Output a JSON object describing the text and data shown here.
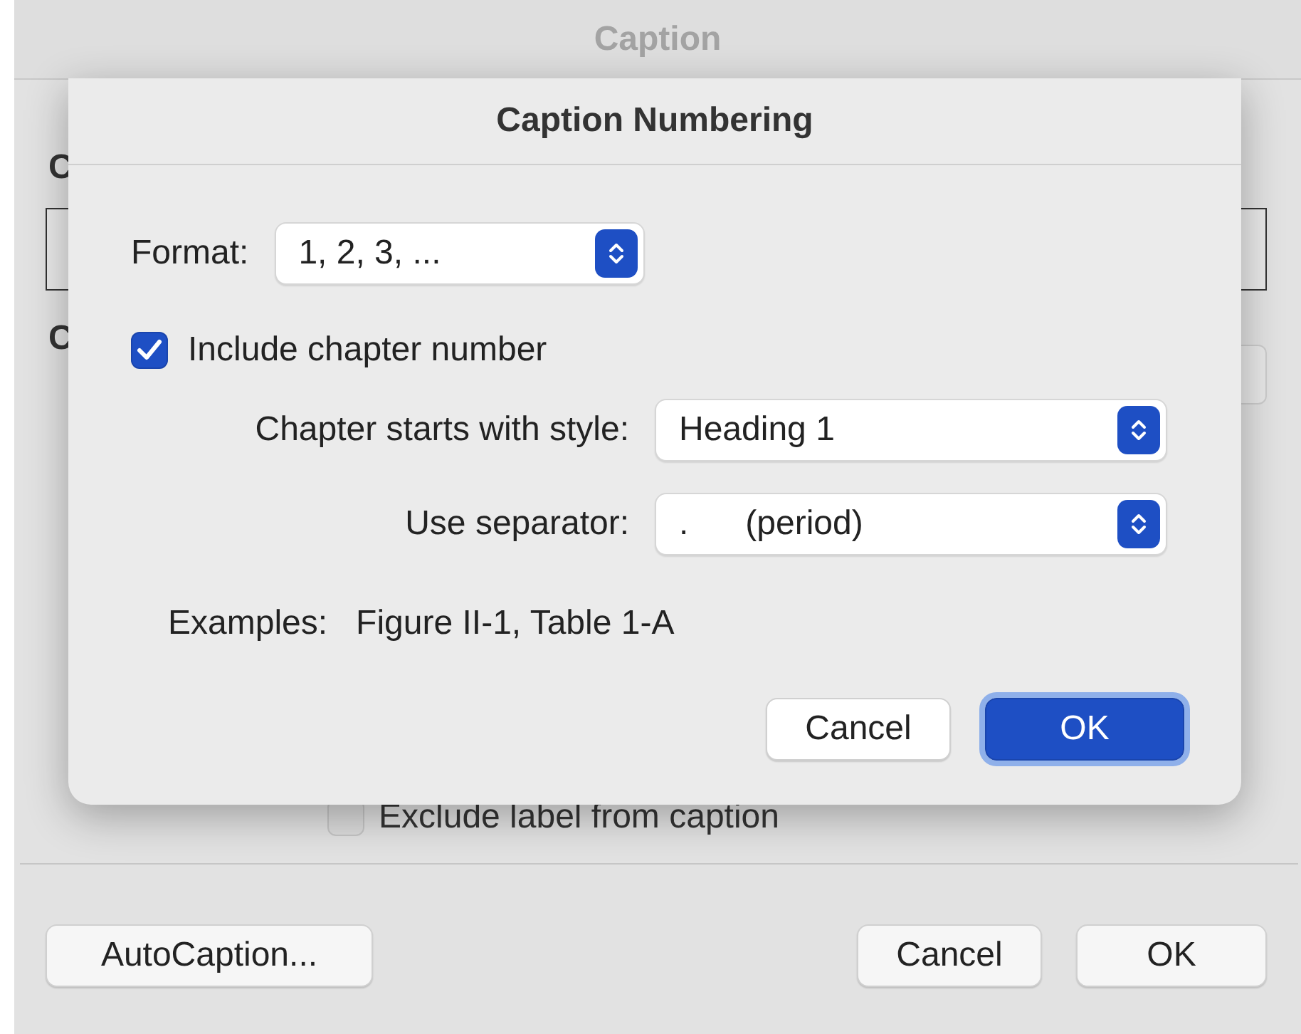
{
  "window": {
    "title": "Caption"
  },
  "background": {
    "labels": [
      "C",
      "C"
    ],
    "exclude_label": {
      "label": "Exclude label from caption",
      "checked": false
    },
    "buttons": {
      "autocaption": "AutoCaption...",
      "cancel": "Cancel",
      "ok": "OK"
    }
  },
  "sheet": {
    "title": "Caption Numbering",
    "format": {
      "label": "Format:",
      "value": "1, 2, 3, ..."
    },
    "include_chapter": {
      "label": "Include chapter number",
      "checked": true
    },
    "chapter_style": {
      "label": "Chapter starts with style:",
      "value": "Heading 1"
    },
    "separator": {
      "label": "Use separator:",
      "value": ".",
      "description": "(period)"
    },
    "examples": {
      "label": "Examples:",
      "value": "Figure II-1, Table 1-A"
    },
    "buttons": [
      {
        "label": "Cancel",
        "default": false
      },
      {
        "label": "OK",
        "default": true
      }
    ]
  }
}
